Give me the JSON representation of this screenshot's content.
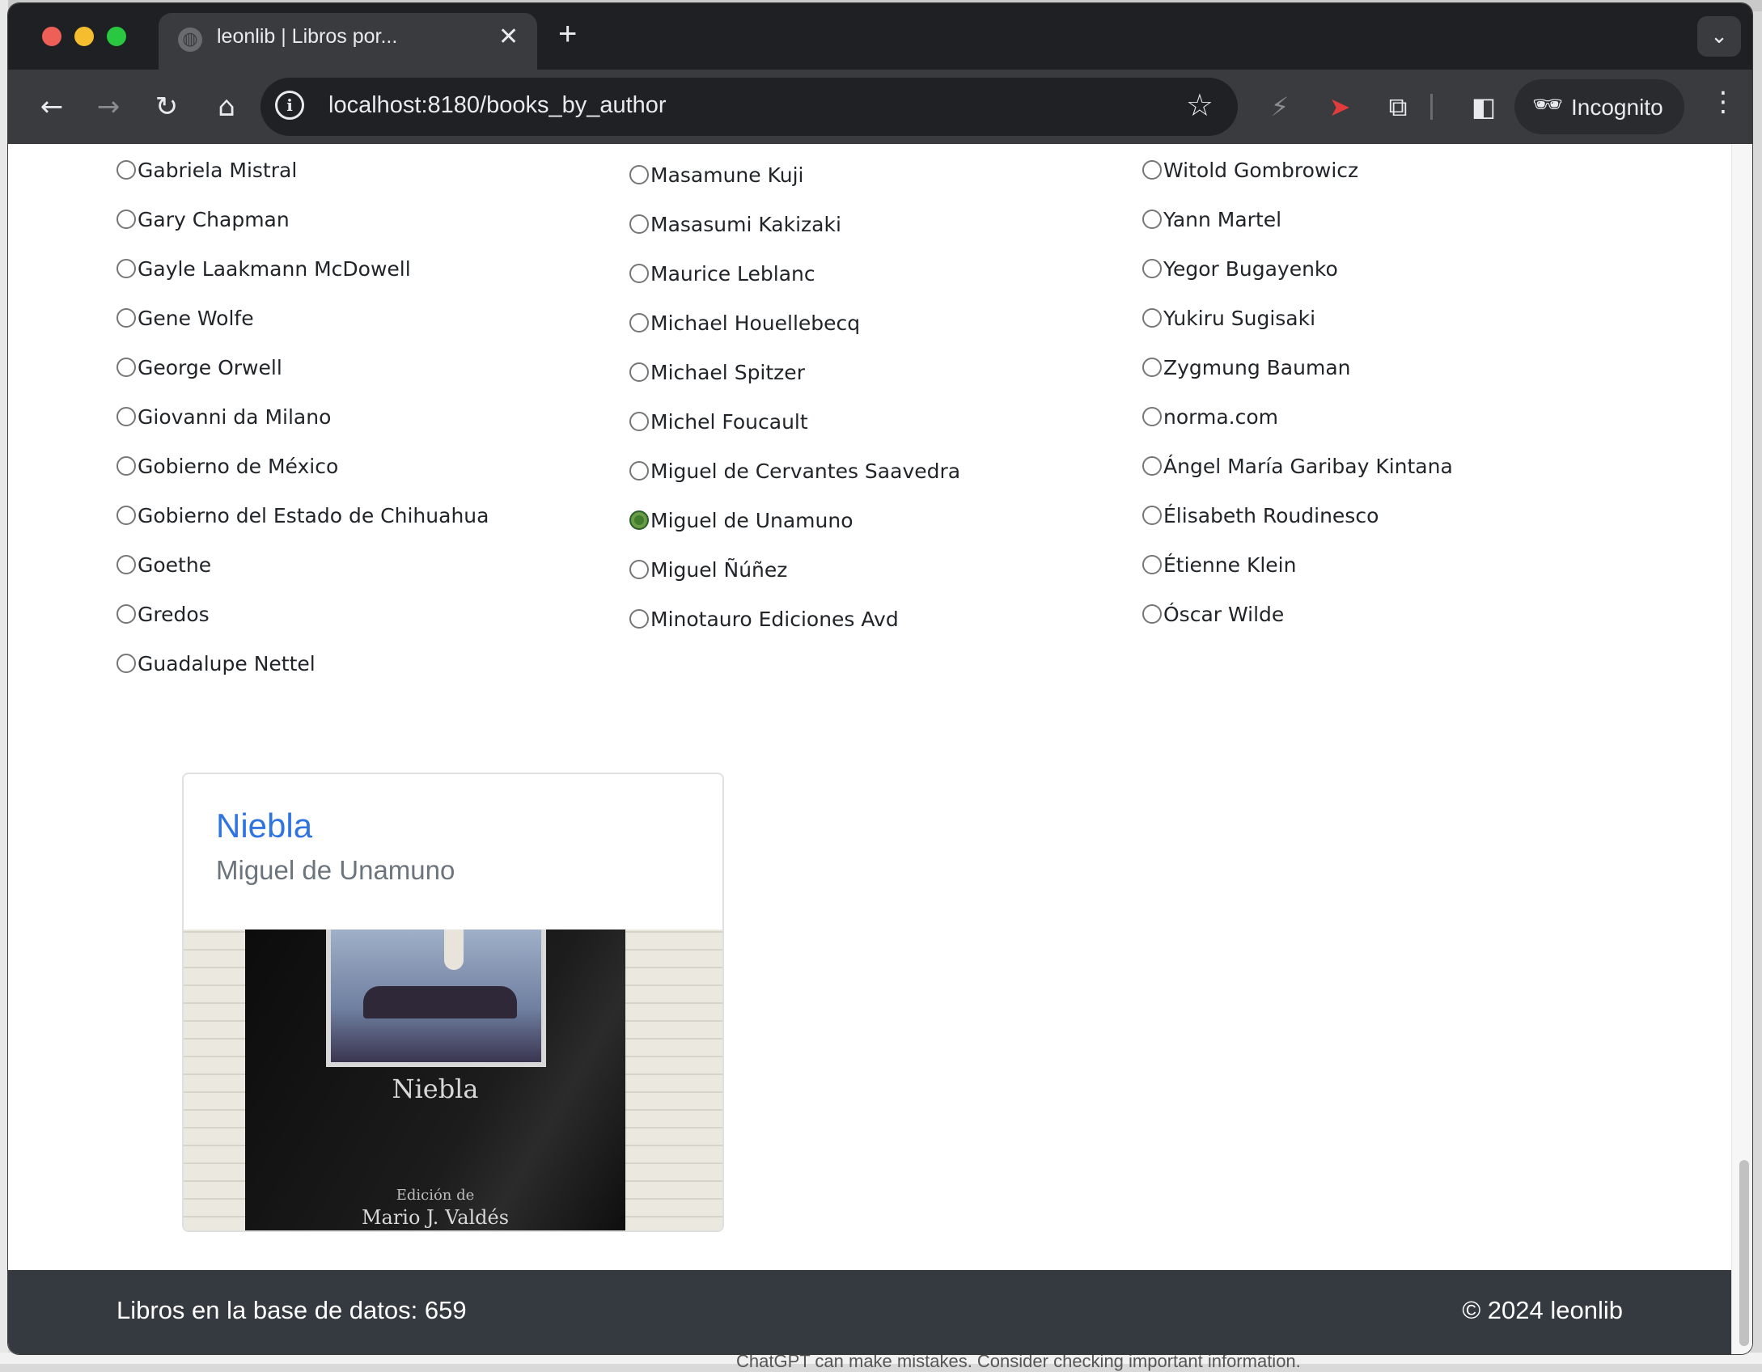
{
  "browser": {
    "tab_title": "leonlib | Libros por...",
    "tab_close": "✕",
    "new_tab": "+",
    "url": "localhost:8180/books_by_author",
    "profile_label": "Incognito"
  },
  "authors": {
    "col1": [
      "Gabriela Mistral",
      "Gary Chapman",
      "Gayle Laakmann McDowell",
      "Gene Wolfe",
      "George Orwell",
      "Giovanni da Milano",
      "Gobierno de México",
      "Gobierno del Estado de Chihuahua",
      "Goethe",
      "Gredos",
      "Guadalupe Nettel"
    ],
    "col2": [
      "Masamune Kuji",
      "Masasumi Kakizaki",
      "Maurice Leblanc",
      "Michael Houellebecq",
      "Michael Spitzer",
      "Michel Foucault",
      "Miguel de Cervantes Saavedra",
      "Miguel de Unamuno",
      "Miguel Ñúñez",
      "Minotauro Ediciones Avd"
    ],
    "col3": [
      "Witold Gombrowicz",
      "Yann Martel",
      "Yegor Bugayenko",
      "Yukiru Sugisaki",
      "Zygmung Bauman",
      "norma.com",
      "Ángel María Garibay Kintana",
      "Élisabeth Roudinesco",
      "Étienne Klein",
      "Óscar Wilde"
    ],
    "selected": "Miguel de Unamuno"
  },
  "book": {
    "title": "Niebla",
    "author": "Miguel de Unamuno",
    "cover_title": "Niebla",
    "cover_edition_line": "Edición de",
    "cover_editor": "Mario J. Valdés"
  },
  "footer": {
    "count_text": "Libros en la base de datos: 659",
    "copyright": "© 2024 leonlib"
  },
  "background_text": "ChatGPT can make mistakes. Consider checking important information."
}
